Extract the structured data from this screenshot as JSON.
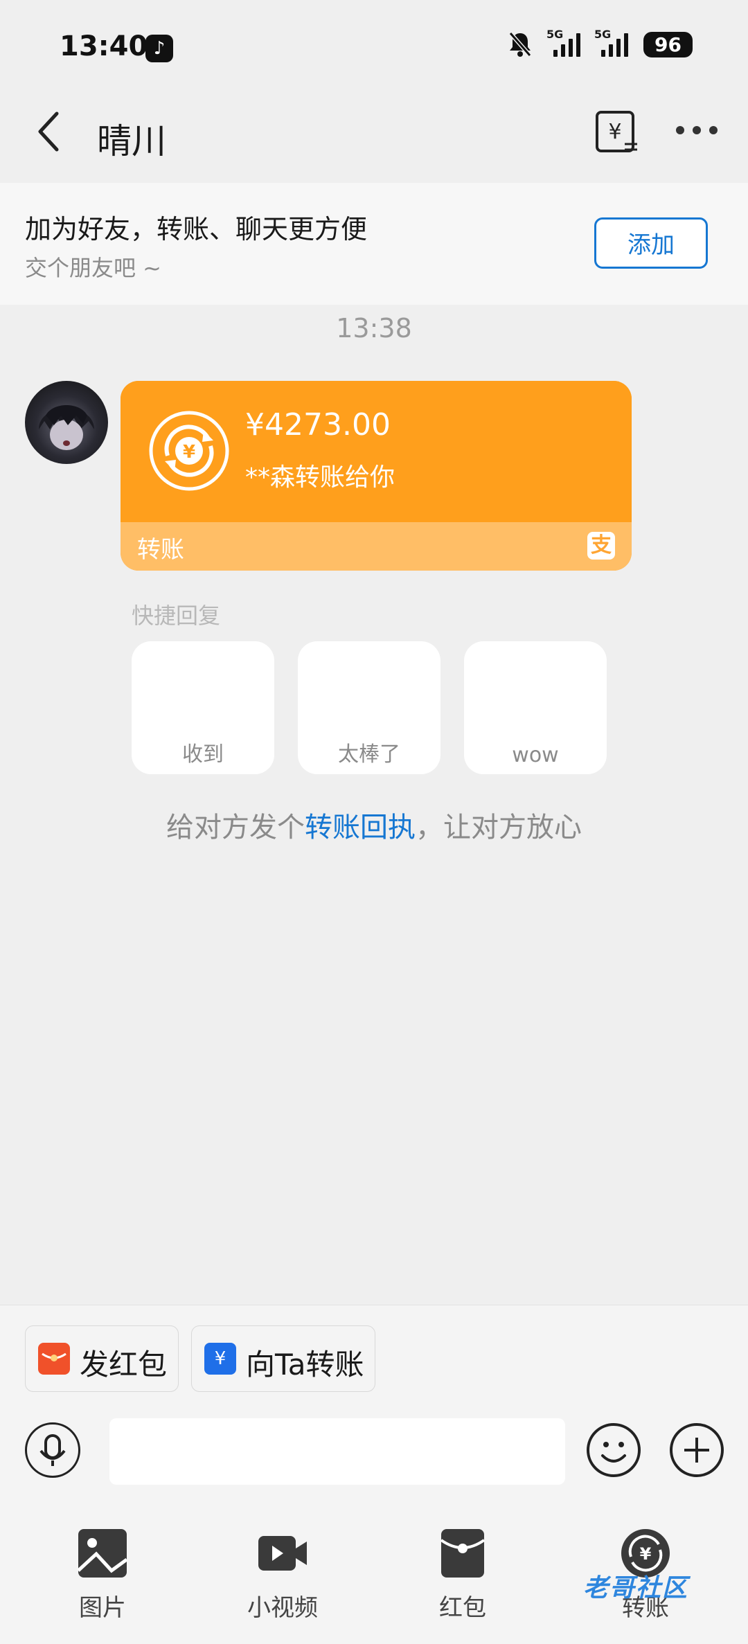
{
  "status_bar": {
    "time": "13:40",
    "network_1": "5G",
    "network_2": "5G",
    "battery": "96"
  },
  "header": {
    "title": "晴川"
  },
  "banner": {
    "title": "加为好友，转账、聊天更方便",
    "subtitle": "交个朋友吧 ~",
    "add_label": "添加"
  },
  "chat": {
    "timestamp": "13:38",
    "transfer_card": {
      "amount": "¥4273.00",
      "description": "**森转账给你",
      "label": "转账"
    }
  },
  "quick_reply": {
    "title": "快捷回复",
    "items": [
      "收到",
      "太棒了",
      "wow"
    ]
  },
  "receipt_tip": {
    "before": "给对方发个",
    "link": "转账回执",
    "after": "，让对方放心"
  },
  "actions": {
    "red_packet": "发红包",
    "transfer": "向Ta转账"
  },
  "toolbar": {
    "items": [
      "图片",
      "小视频",
      "红包",
      "转账"
    ]
  },
  "watermark": "老哥社区",
  "colors": {
    "accent": "#1677d2",
    "card": "#ff9f1c",
    "card_footer": "#ffbe66",
    "red": "#f0512a",
    "blue": "#1f6fe8"
  }
}
